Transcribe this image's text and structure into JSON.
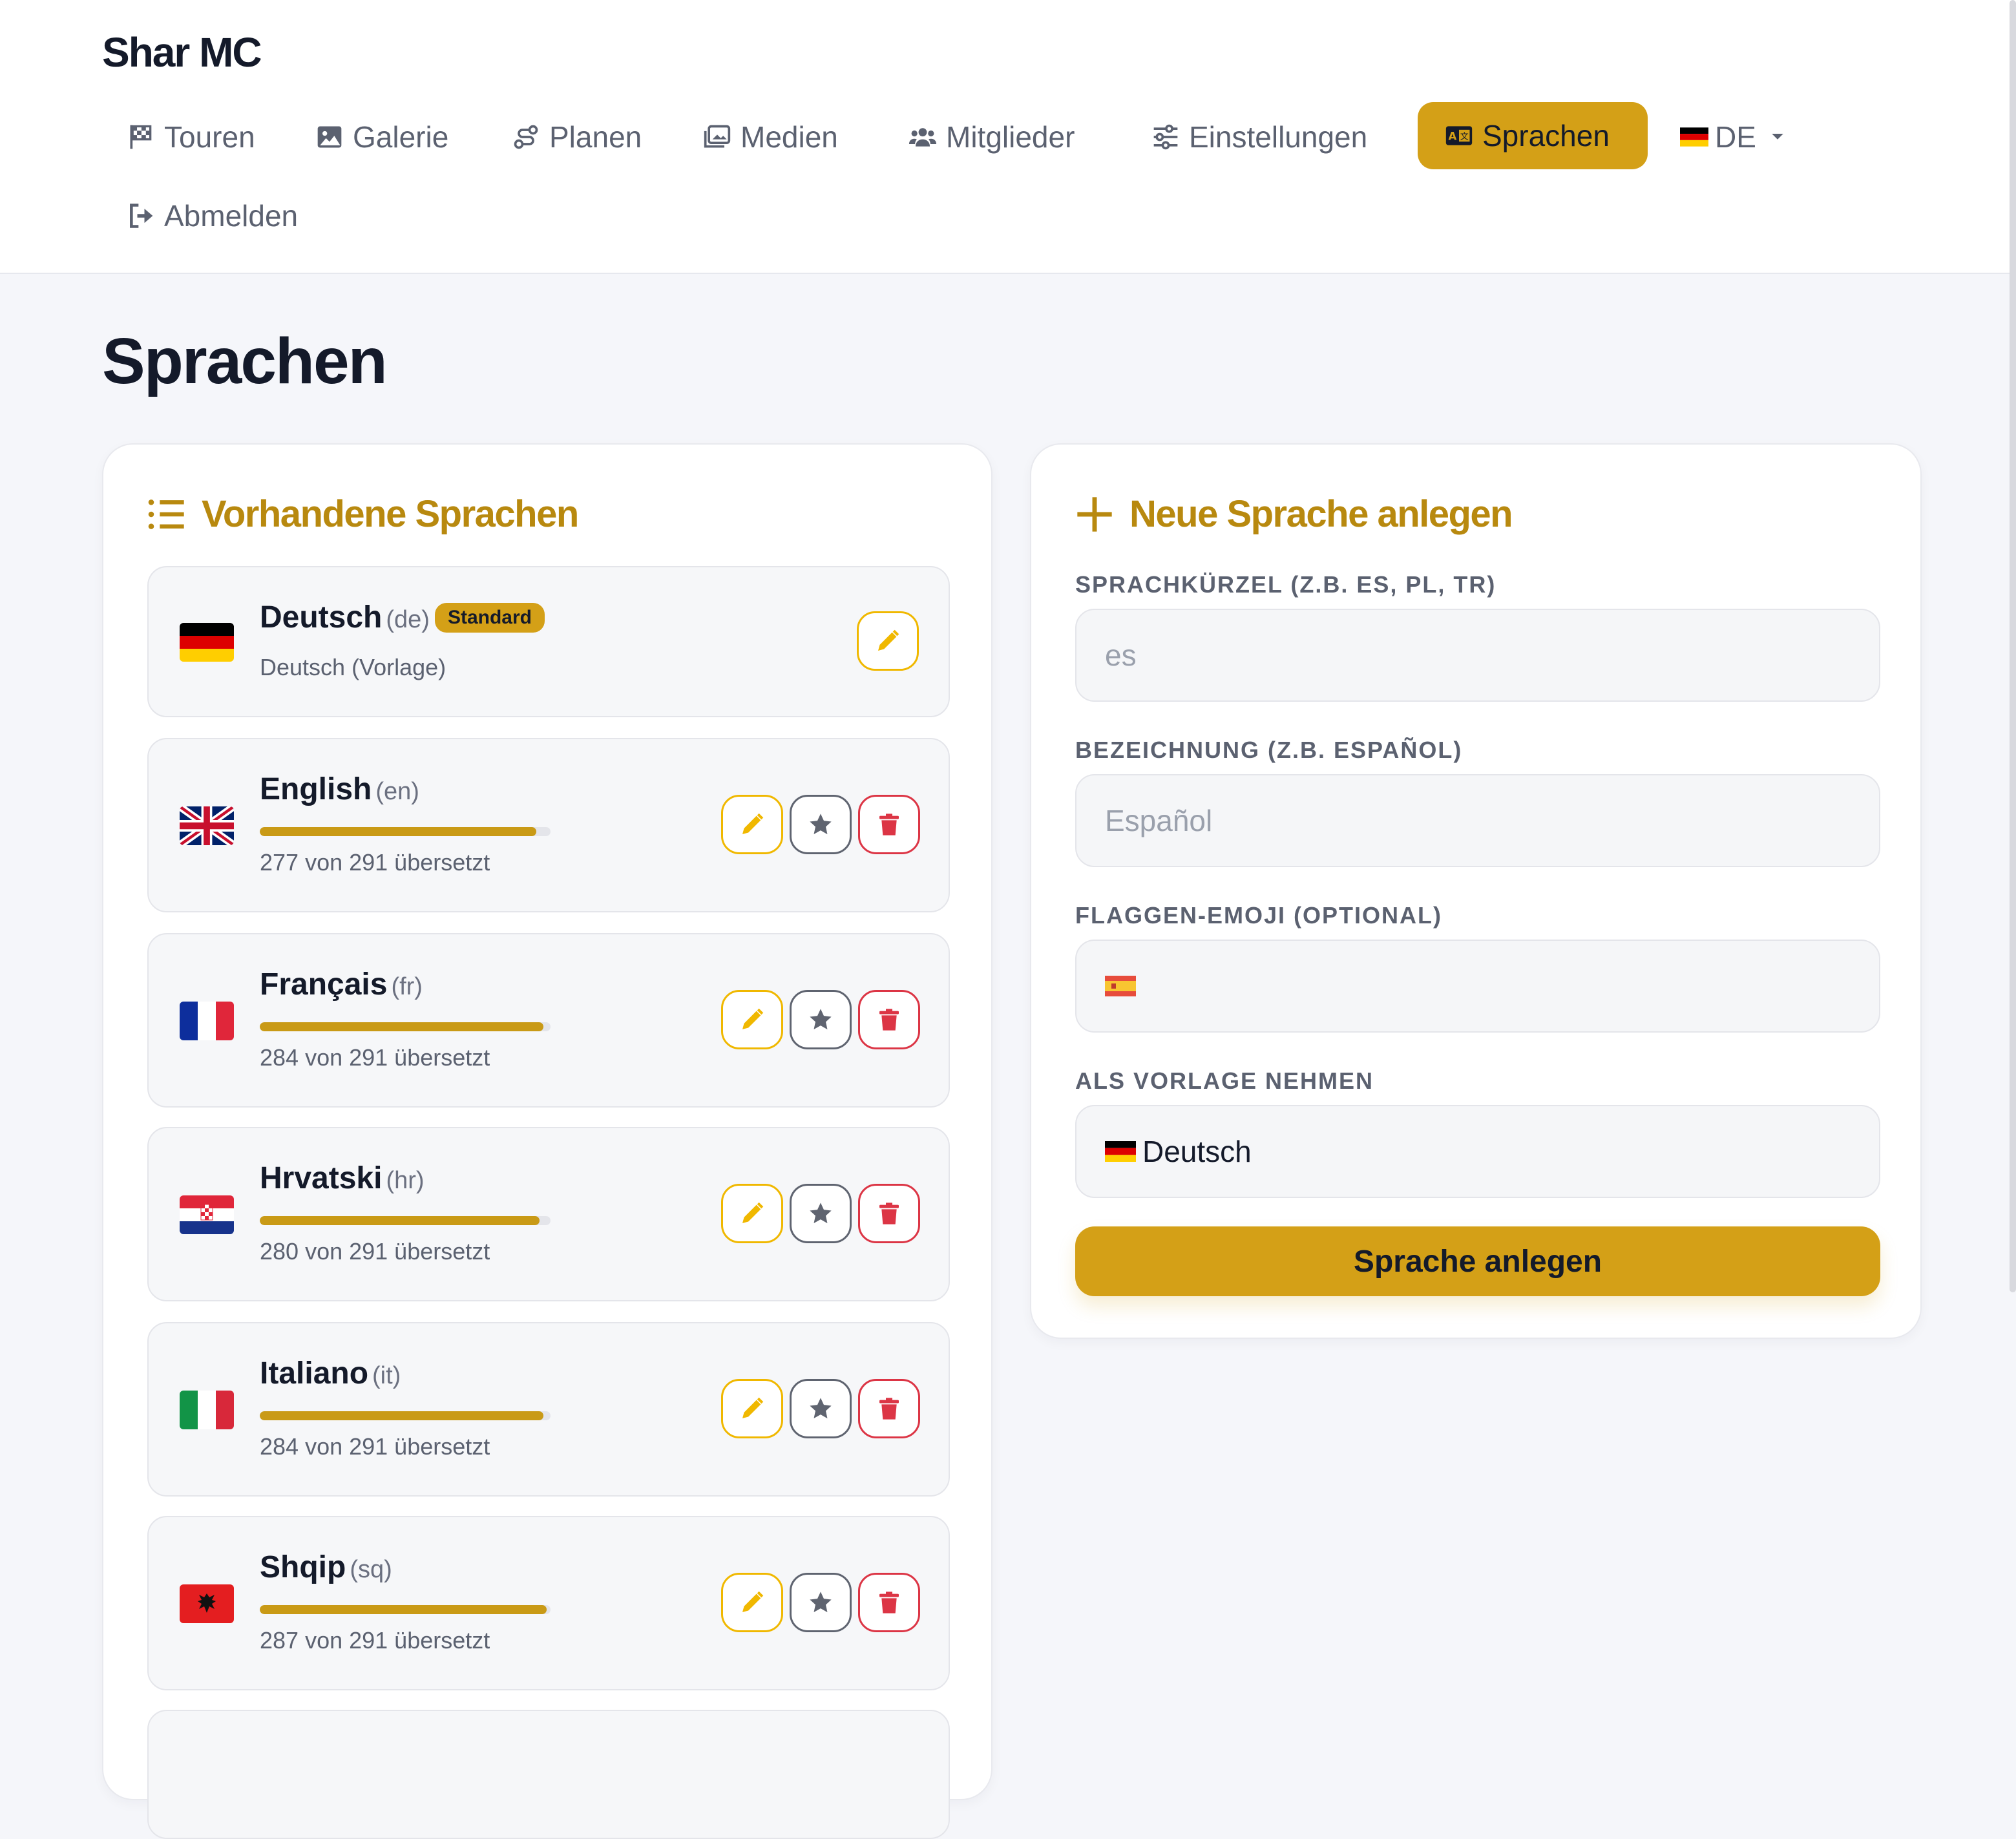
{
  "brand": "Shar MC",
  "nav": {
    "touren": "Touren",
    "galerie": "Galerie",
    "planen": "Planen",
    "medien": "Medien",
    "mitglieder": "Mitglieder",
    "einstellungen": "Einstellungen",
    "sprachen": "Sprachen",
    "language": "DE",
    "abmelden": "Abmelden"
  },
  "page_title": "Sprachen",
  "existing": {
    "title": "Vorhandene Sprachen",
    "languages": [
      {
        "name": "Deutsch",
        "code": "(de)",
        "badge": "Standard",
        "subtitle": "Deutsch (Vorlage)",
        "flag": "de"
      },
      {
        "name": "English",
        "code": "(en)",
        "progress": 0.952,
        "subtitle": "277 von 291 übersetzt",
        "flag": "gb"
      },
      {
        "name": "Français",
        "code": "(fr)",
        "progress": 0.976,
        "subtitle": "284 von 291 übersetzt",
        "flag": "fr"
      },
      {
        "name": "Hrvatski",
        "code": "(hr)",
        "progress": 0.962,
        "subtitle": "280 von 291 übersetzt",
        "flag": "hr"
      },
      {
        "name": "Italiano",
        "code": "(it)",
        "progress": 0.976,
        "subtitle": "284 von 291 übersetzt",
        "flag": "it"
      },
      {
        "name": "Shqip",
        "code": "(sq)",
        "progress": 0.986,
        "subtitle": "287 von 291 übersetzt",
        "flag": "al"
      }
    ]
  },
  "new_language": {
    "title": "Neue Sprache anlegen",
    "code_label": "SPRACHKÜRZEL (Z.B. ES, PL, TR)",
    "code_placeholder": "es",
    "name_label": "BEZEICHNUNG (Z.B. ESPAÑOL)",
    "name_placeholder": "Español",
    "flag_label": "FLAGGEN-EMOJI (OPTIONAL)",
    "template_label": "ALS VORLAGE NEHMEN",
    "template_value": "Deutsch",
    "submit_label": "Sprache anlegen"
  },
  "colors": {
    "accent": "#d4a017",
    "accent_text": "#b8890f",
    "danger": "#dc3545",
    "background": "#f5f6fa"
  }
}
